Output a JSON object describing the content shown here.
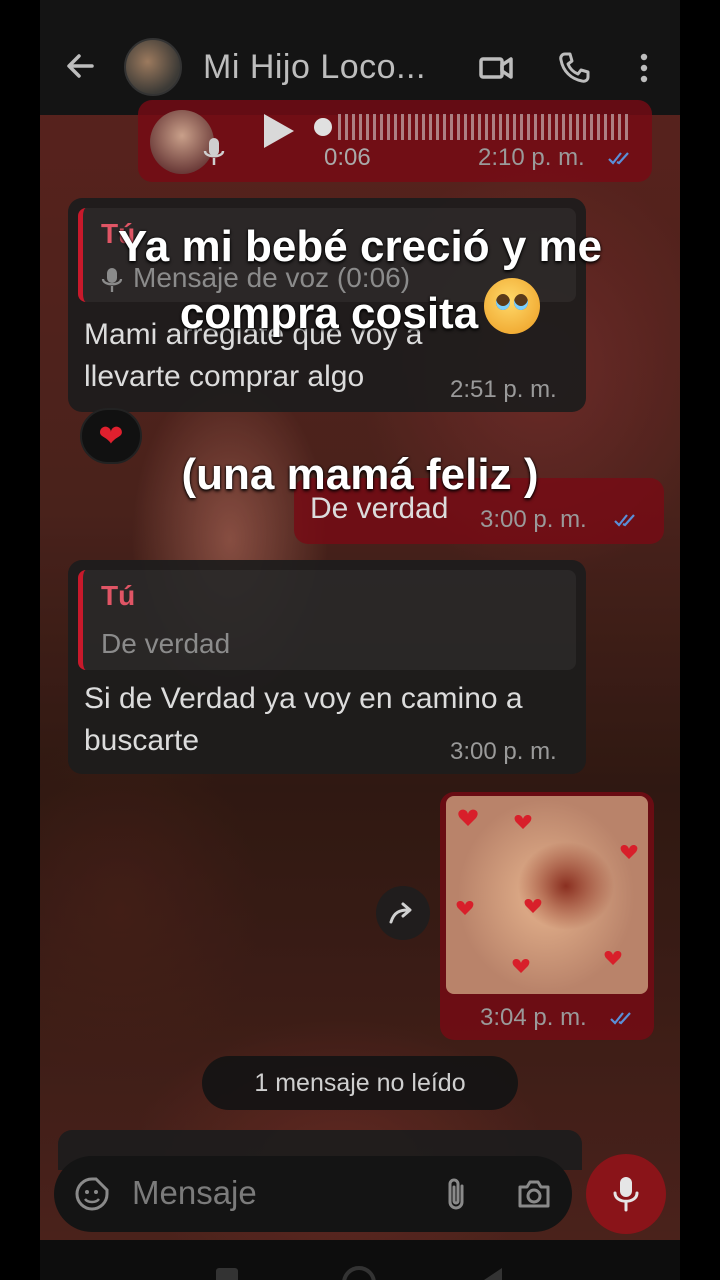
{
  "header": {
    "contact_name": "Mi Hijo Loco...",
    "icons": [
      "back-arrow-icon",
      "video-call-icon",
      "phone-icon",
      "more-vert-icon"
    ]
  },
  "messages": {
    "voice_out": {
      "duration": "0:06",
      "time": "2:10 p. m."
    },
    "reply_in_1": {
      "quote_author": "Tú",
      "quote_text": "Mensaje de voz (0:06)",
      "text": "Mami arreglate que voy a llevarte comprar algo",
      "time": "2:51 p. m.",
      "reaction": "❤"
    },
    "out_verdad": {
      "text": "De verdad",
      "time": "3:00 p. m."
    },
    "reply_in_2": {
      "quote_author": "Tú",
      "quote_text": "De verdad",
      "text": "Si de Verdad ya voy en camino a buscarte",
      "time": "3:00 p. m."
    },
    "image_out": {
      "time": "3:04 p. m."
    }
  },
  "unread_label": "1 mensaje no leído",
  "input": {
    "placeholder": "Mensaje"
  },
  "overlay": {
    "line1": "Ya mi bebé creció y me",
    "line2": "compra cosita",
    "line3": "(una mamá feliz )"
  },
  "colors": {
    "accent": "#c8192b",
    "out_bubble": "#780a14",
    "ticks": "#5a8fd8"
  }
}
